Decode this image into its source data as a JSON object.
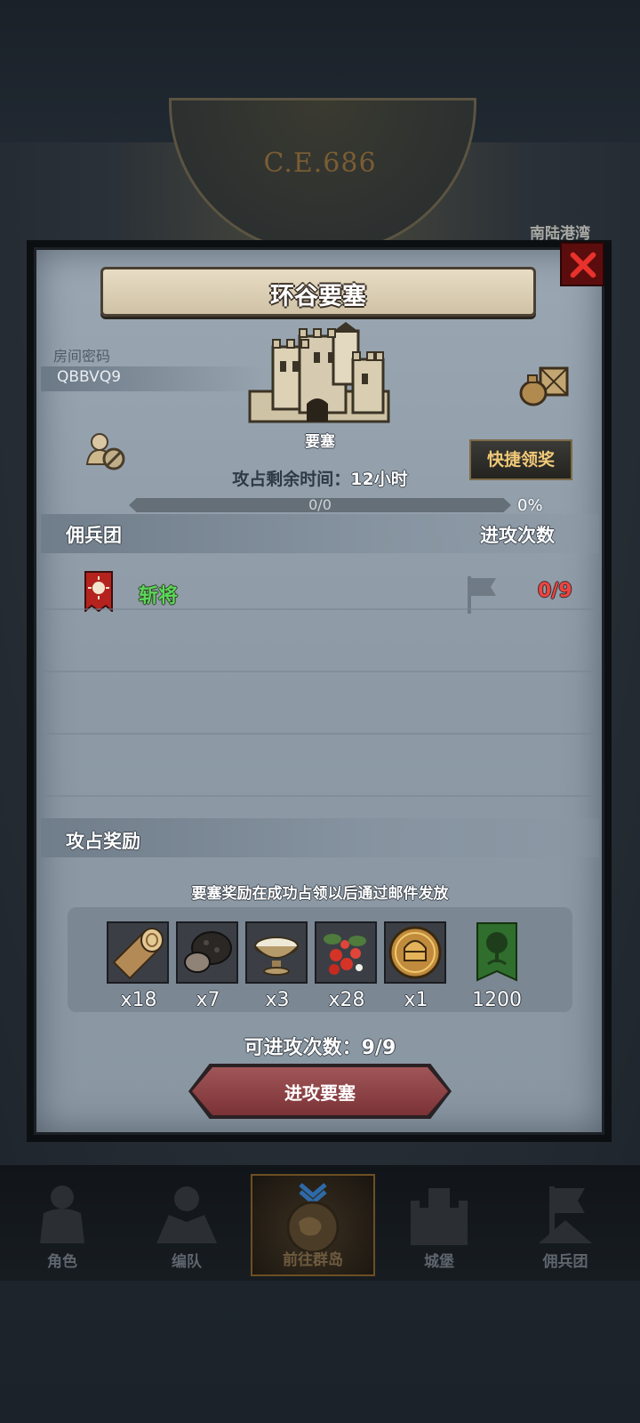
{
  "header": {
    "era": "C.E.686",
    "side_label": "南陆港湾"
  },
  "dialog": {
    "title": "环谷要塞",
    "room_label": "房间密码",
    "room_code": "QBBVQ9",
    "building_name": "要塞",
    "remaining_label": "攻占剩余时间：",
    "remaining_value": "12小时",
    "progress": {
      "text": "0/0",
      "percent_label": "0%",
      "fraction": 0
    },
    "quick_claim_label": "快捷领奖",
    "mercenary_section": {
      "title": "佣兵团",
      "attack_count_label": "进攻次数"
    },
    "mercenaries": [
      {
        "name": "斩将",
        "count": "0/9"
      }
    ],
    "reward_section": {
      "title": "攻占奖励",
      "note": "要塞奖励在成功占领以后通过邮件发放",
      "items": [
        {
          "icon": "log-icon",
          "qty": "x18"
        },
        {
          "icon": "truffle-icon",
          "qty": "x7"
        },
        {
          "icon": "bowl-icon",
          "qty": "x3"
        },
        {
          "icon": "berries-icon",
          "qty": "x28"
        },
        {
          "icon": "helmet-coin-icon",
          "qty": "x1"
        },
        {
          "icon": "tree-banner-icon",
          "qty": "1200"
        }
      ]
    },
    "attacks_left": "可进攻次数：9/9",
    "attack_button_label": "进攻要塞"
  },
  "nav": [
    {
      "label": "角色",
      "icon": "knight-icon"
    },
    {
      "label": "编队",
      "icon": "squad-icon"
    },
    {
      "label": "前往群岛",
      "icon": "globe-icon",
      "active": true
    },
    {
      "label": "城堡",
      "icon": "castle-icon"
    },
    {
      "label": "佣兵团",
      "icon": "mercenary-icon"
    }
  ],
  "colors": {
    "accent_gold": "#f1c978",
    "green_name": "#5bd75a",
    "red_count": "#ef4440",
    "attack_button": "#8e4245"
  }
}
